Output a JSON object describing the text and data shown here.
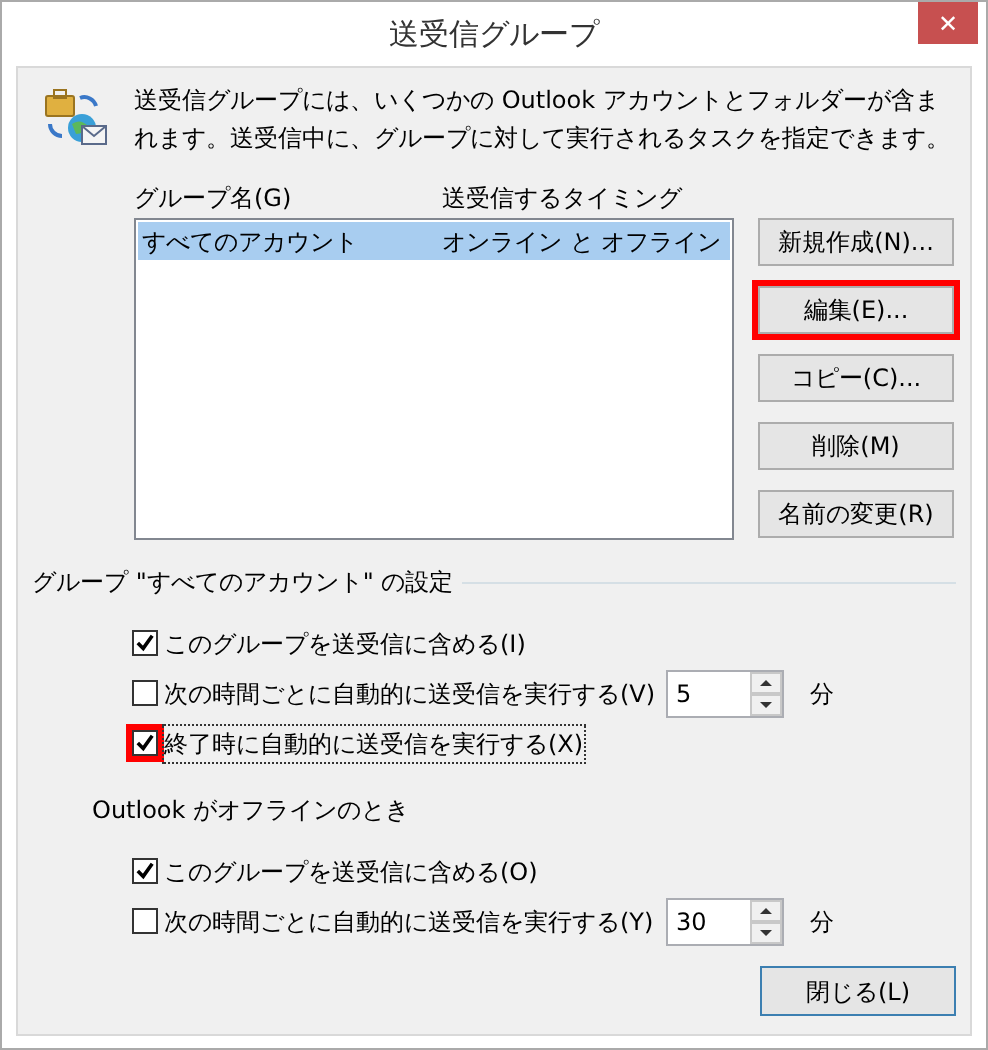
{
  "window": {
    "title": "送受信グループ",
    "close": "✕"
  },
  "description": "送受信グループには、いくつかの Outlook アカウントとフォルダーが含まれます。送受信中に、グループに対して実行されるタスクを指定できます。",
  "table": {
    "columns": [
      "グループ名(G)",
      "送受信するタイミング"
    ],
    "rows": [
      {
        "cells": [
          "すべてのアカウント",
          "オンライン と オフライン"
        ],
        "selected": true
      }
    ]
  },
  "buttons": [
    {
      "label": "新規作成(N)...",
      "highlighted": false
    },
    {
      "label": "編集(E)...",
      "highlighted": true
    },
    {
      "label": "コピー(C)...",
      "highlighted": false
    },
    {
      "label": "削除(M)",
      "highlighted": false
    },
    {
      "label": "名前の変更(R)",
      "highlighted": false
    }
  ],
  "sections": [
    {
      "title": "グループ \"すべてのアカウント\" の設定",
      "kind": "group",
      "options": [
        {
          "label": "このグループを送受信に含める(I)",
          "checked": true,
          "highlighted": false,
          "focused": false
        },
        {
          "label": "次の時間ごとに自動的に送受信を実行する(V)",
          "checked": false,
          "highlighted": false,
          "focused": false,
          "value": "5",
          "unit": "分"
        },
        {
          "label": "終了時に自動的に送受信を実行する(X)",
          "checked": true,
          "highlighted": true,
          "focused": true
        }
      ]
    },
    {
      "title": "Outlook がオフラインのとき",
      "kind": "plain",
      "options": [
        {
          "label": "このグループを送受信に含める(O)",
          "checked": true,
          "highlighted": false,
          "focused": false
        },
        {
          "label": "次の時間ごとに自動的に送受信を実行する(Y)",
          "checked": false,
          "highlighted": false,
          "focused": false,
          "value": "30",
          "unit": "分"
        }
      ]
    }
  ],
  "close_button": "閉じる(L)"
}
